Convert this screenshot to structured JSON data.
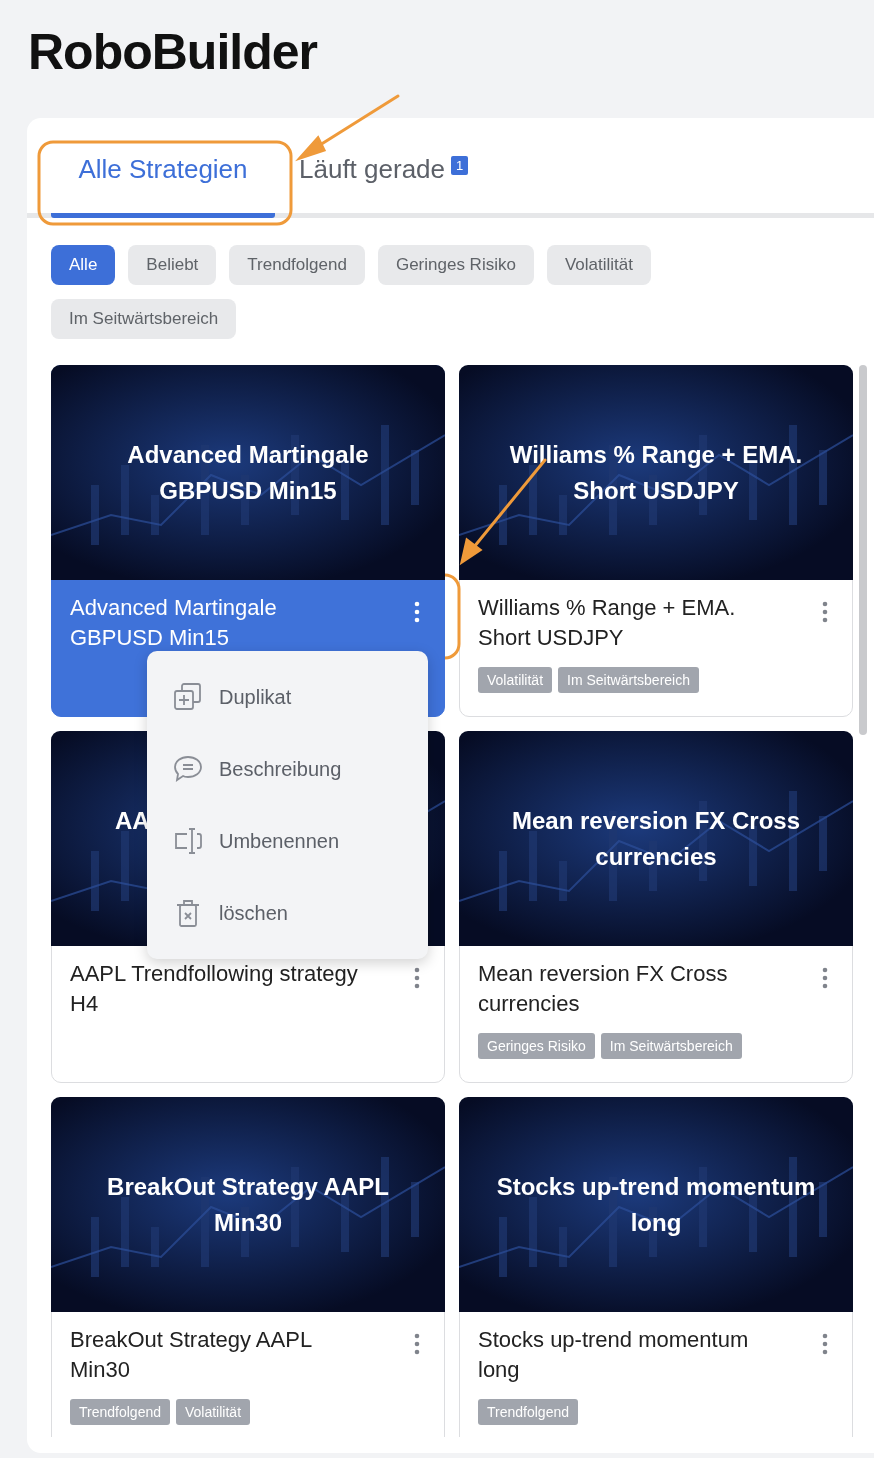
{
  "app_title": "RoboBuilder",
  "tabs": [
    {
      "label": "Alle Strategien",
      "selected": true
    },
    {
      "label": "Läuft gerade",
      "selected": false,
      "badge": "1"
    }
  ],
  "filters": [
    {
      "label": "Alle",
      "selected": true
    },
    {
      "label": "Beliebt",
      "selected": false
    },
    {
      "label": "Trendfolgend",
      "selected": false
    },
    {
      "label": "Geringes Risiko",
      "selected": false
    },
    {
      "label": "Volatilität",
      "selected": false
    },
    {
      "label": "Im Seitwärtsbereich",
      "selected": false
    }
  ],
  "cards": [
    {
      "image_title": "Advanced Martingale GBPUSD Min15",
      "title": "Advanced Martingale GBPUSD Min15",
      "selected": true,
      "menu": [
        {
          "kind": "duplicate",
          "label": "Duplikat"
        },
        {
          "kind": "comment",
          "label": "Beschreibung"
        },
        {
          "kind": "rename",
          "label": "Umbenennen"
        },
        {
          "kind": "delete",
          "label": "löschen"
        }
      ]
    },
    {
      "image_title": "Williams % Range + EMA. Short USDJPY",
      "title": "Williams % Range + EMA. Short USDJPY",
      "selected": false,
      "tags": [
        "Volatilität",
        "Im Seitwärtsbereich"
      ]
    },
    {
      "image_title": "AA",
      "image_title_cut": true,
      "title": "AAPL Trendfollowing strategy H4",
      "selected": false
    },
    {
      "image_title": "Mean reversion FX Cross currencies",
      "title": "Mean reversion FX Cross currencies",
      "selected": false,
      "tags": [
        "Geringes Risiko",
        "Im Seitwärtsbereich"
      ]
    },
    {
      "image_title": "BreakOut Strategy AAPL Min30",
      "title": "BreakOut Strategy AAPL Min30",
      "selected": false,
      "tags": [
        "Trendfolgend",
        "Volatilität"
      ]
    },
    {
      "image_title": "Stocks up-trend momentum long",
      "title": "Stocks up-trend momentum long",
      "selected": false,
      "tags": [
        "Trendfolgend"
      ]
    }
  ]
}
